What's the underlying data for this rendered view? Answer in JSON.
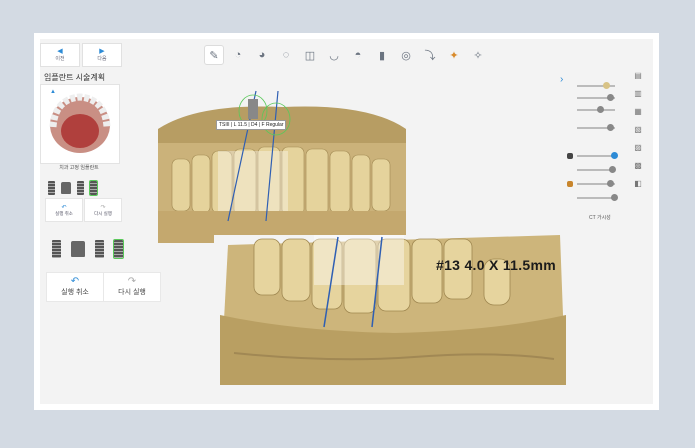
{
  "nav": {
    "prev": "이전",
    "next": "다음"
  },
  "plan_title": "임플란트 시술계획",
  "thumb_caption": "치과 고정 임플란트",
  "actions_small": {
    "undo": "실행 취소",
    "redo": "다시 실행"
  },
  "actions_big": {
    "undo": "실행 취소",
    "redo": "다시 실행"
  },
  "implant_label": "TSIII | L 11.5 | D4 | F Regular",
  "zoom_label": "#13 4.0 X 11.5mm",
  "right_panel": {
    "ct_label": "CT 가시성"
  },
  "colors": {
    "accent": "#2d8bd6",
    "selected": "#5ac85a",
    "bone": "#d8c386",
    "frame_bg": "#d3dae3"
  }
}
